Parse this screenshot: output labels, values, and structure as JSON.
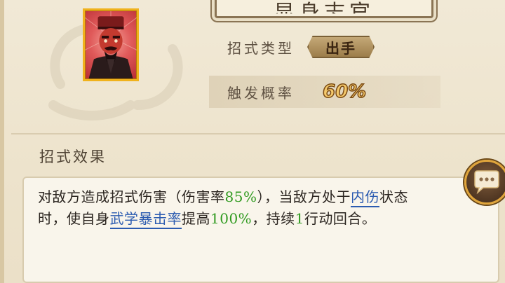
{
  "header": {
    "title": "显身志官"
  },
  "skill": {
    "type_label": "招式类型",
    "type_value": "出手",
    "trigger_label": "触发概率",
    "trigger_value": "60%"
  },
  "effect": {
    "section_label": "招式效果",
    "line1_a": "对敌方造成招式伤害（伤害率",
    "line1_pct": "85%",
    "line1_b": "），当敌方处于",
    "line1_link": "内伤",
    "line1_c": "状态",
    "line2_a": "时，使自身",
    "line2_link": "武学暴击率",
    "line2_b": "提高",
    "line2_pct": "100%",
    "line2_c": "，持续",
    "line2_num": "1",
    "line2_d": "行动回合。"
  },
  "icons": {
    "portrait": "character-portrait",
    "chat": "chat-bubble-icon"
  },
  "colors": {
    "highlight_green": "#2f9a1f",
    "link_blue": "#2b5bb0",
    "gold": "#f0b21c"
  }
}
